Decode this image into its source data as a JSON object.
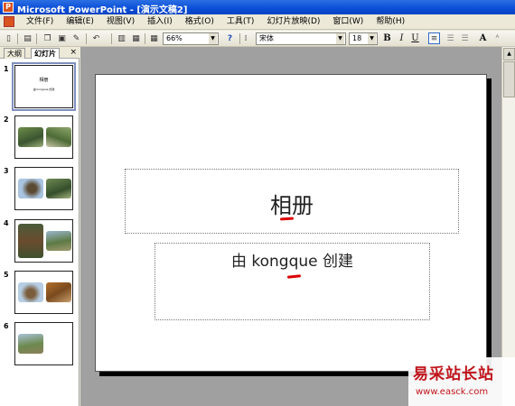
{
  "window": {
    "title": "Microsoft PowerPoint - [演示文稿2]"
  },
  "menu": {
    "items": [
      {
        "label": "文件(F)"
      },
      {
        "label": "编辑(E)"
      },
      {
        "label": "视图(V)"
      },
      {
        "label": "插入(I)"
      },
      {
        "label": "格式(O)"
      },
      {
        "label": "工具(T)"
      },
      {
        "label": "幻灯片放映(D)"
      },
      {
        "label": "窗口(W)"
      },
      {
        "label": "帮助(H)"
      }
    ]
  },
  "toolbar": {
    "zoom": "66%",
    "font_name": "宋体",
    "font_size": "18",
    "bold": "B",
    "italic": "I",
    "underline": "U",
    "font_grow": "A"
  },
  "panel": {
    "tab_outline": "大纲",
    "tab_slides": "幻灯片",
    "close": "×",
    "thumbnails": [
      {
        "number": "1",
        "title": "相册",
        "subtitle": "由 kongque 创建"
      },
      {
        "number": "2"
      },
      {
        "number": "3"
      },
      {
        "number": "4"
      },
      {
        "number": "5"
      },
      {
        "number": "6"
      }
    ]
  },
  "slide": {
    "title": "相册",
    "subtitle": "由 kongque 创建"
  },
  "watermark": {
    "title": "易采站长站",
    "url": "www.easck.com"
  },
  "colors": {
    "titlebar": "#0a4ed8",
    "workspace": "#a0a0a0",
    "annotation_red": "#d00000",
    "watermark_red": "#c0141b"
  }
}
